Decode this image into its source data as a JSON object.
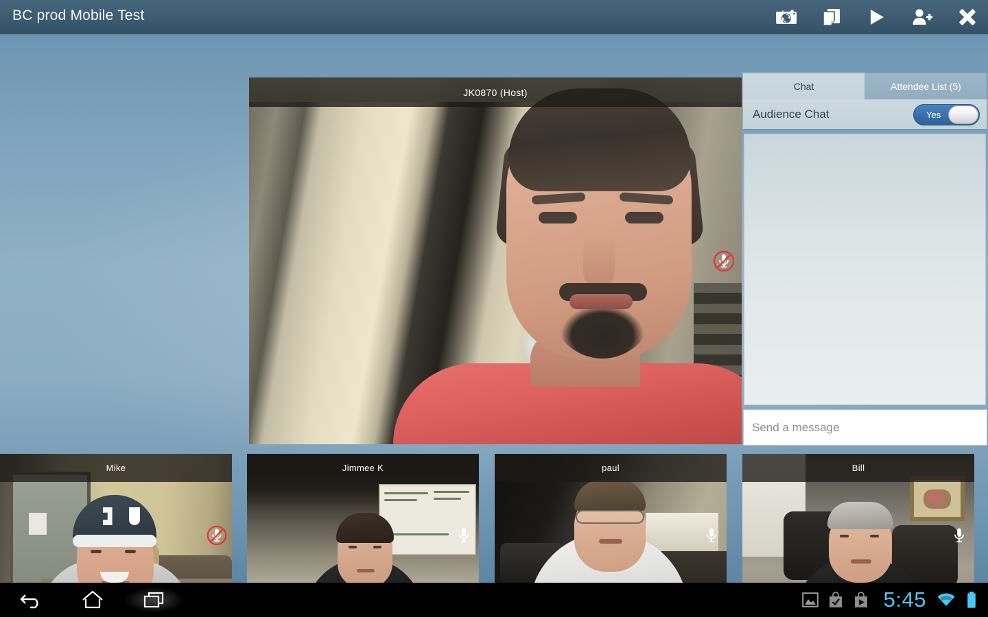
{
  "titlebar": {
    "title": "BC prod Mobile Test",
    "actions": [
      {
        "name": "switch-camera-icon",
        "label": "Switch Camera"
      },
      {
        "name": "documents-icon",
        "label": "Documents"
      },
      {
        "name": "play-icon",
        "label": "Play"
      },
      {
        "name": "add-attendee-icon",
        "label": "Add Attendee"
      },
      {
        "name": "close-icon",
        "label": "Close"
      }
    ]
  },
  "main_video": {
    "name": "JK0870 (Host)",
    "muted": true,
    "mic_icon": "mic-muted-icon"
  },
  "thumbnails": [
    {
      "name": "Mike",
      "muted": true,
      "mic_icon": "mic-muted-icon"
    },
    {
      "name": "Jimmee K",
      "muted": false,
      "mic_icon": "mic-icon"
    },
    {
      "name": "paul",
      "muted": false,
      "mic_icon": "mic-icon"
    },
    {
      "name": "Bill",
      "muted": false,
      "mic_icon": "mic-icon"
    }
  ],
  "panel": {
    "tabs": [
      {
        "label": "Chat",
        "active": true
      },
      {
        "label": "Attendee List (5)",
        "active": false
      }
    ],
    "audience_chat": {
      "label": "Audience Chat",
      "toggle_value": "Yes",
      "toggle_on": true
    },
    "messages": [],
    "input": {
      "value": "",
      "placeholder": "Send a message"
    }
  },
  "navbar": {
    "back_label": "Back",
    "home_label": "Home",
    "recents_label": "Recent Apps",
    "status": {
      "clock": "5:45",
      "icons": [
        "image-icon",
        "play-store-checkmark-icon",
        "play-store-icon",
        "wifi-icon",
        "battery-icon"
      ]
    }
  },
  "colors": {
    "titlebar": "#3e5d73",
    "accent": "#3a72ab",
    "clock": "#49c8f5",
    "muted": "#e03a3a",
    "panel_tab_active": "#ccd9e0",
    "panel_tab_inactive": "#9cb6c7"
  }
}
